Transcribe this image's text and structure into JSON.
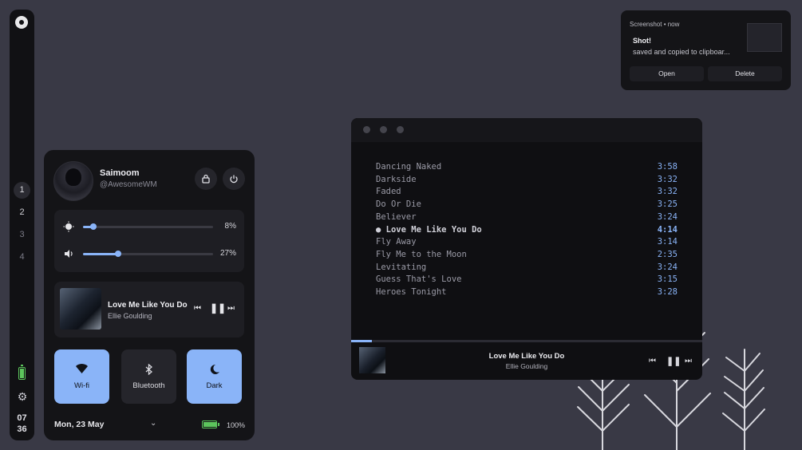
{
  "bar": {
    "workspaces": [
      "1",
      "2",
      "3",
      "4"
    ],
    "clock_hour": "07",
    "clock_minute": "36"
  },
  "control_center": {
    "user_name": "Saimoom",
    "user_handle": "@AwesomeWM",
    "brightness": {
      "value": 8,
      "label": "8%"
    },
    "volume": {
      "value": 27,
      "label": "27%"
    },
    "music": {
      "title": "Love Me Like You Do",
      "artist": "Ellie Goulding"
    },
    "tiles": [
      {
        "label": "Wi-fi",
        "icon": "wifi-icon",
        "active": true
      },
      {
        "label": "Bluetooth",
        "icon": "bluetooth-icon",
        "active": false
      },
      {
        "label": "Dark",
        "icon": "moon-icon",
        "active": true
      }
    ],
    "date": "Mon, 23 May",
    "battery": {
      "value": 100,
      "label": "100%"
    }
  },
  "player": {
    "tracks": [
      {
        "name": "Dancing Naked",
        "duration": "3:58"
      },
      {
        "name": "Darkside",
        "duration": "3:32"
      },
      {
        "name": "Faded",
        "duration": "3:32"
      },
      {
        "name": "Do Or Die",
        "duration": "3:25"
      },
      {
        "name": "Believer",
        "duration": "3:24"
      },
      {
        "name": "Love Me Like You Do",
        "duration": "4:14",
        "current": true
      },
      {
        "name": "Fly Away",
        "duration": "3:14"
      },
      {
        "name": "Fly Me to the Moon",
        "duration": "2:35"
      },
      {
        "name": "Levitating",
        "duration": "3:24"
      },
      {
        "name": "Guess That's Love",
        "duration": "3:15"
      },
      {
        "name": "Heroes Tonight",
        "duration": "3:28"
      }
    ],
    "progress": 0.06,
    "now_playing": {
      "title": "Love Me Like You Do",
      "artist": "Ellie Goulding"
    }
  },
  "notification": {
    "app_line": "Screenshot • now",
    "title": "Shot!",
    "body": "saved and copied to clipboar...",
    "actions": [
      "Open",
      "Delete"
    ]
  },
  "colors": {
    "accent": "#8ab4f8",
    "battery": "#5cc55c",
    "desktop": "#393945"
  }
}
